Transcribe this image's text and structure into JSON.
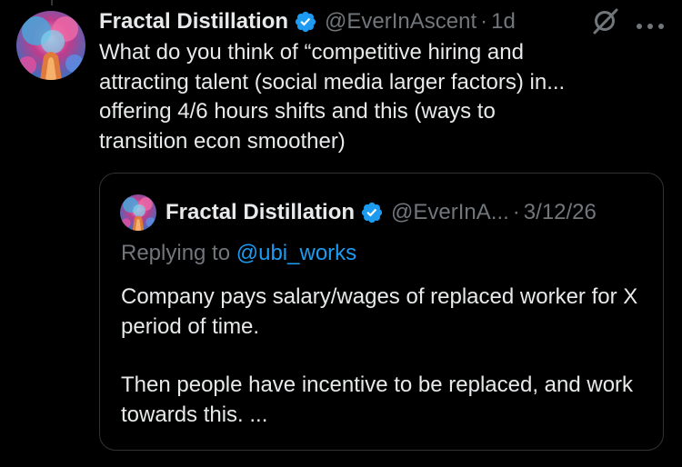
{
  "tweet": {
    "author_name": "Fractal Distillation",
    "handle": "@EverInAscent",
    "separator": "·",
    "time": "1d",
    "text": "What do you think of “competitive hiring and\nattracting talent (social media larger factors) in...\noffering 4/6 hours shifts and this (ways to\ntransition econ smoother)"
  },
  "quoted_tweet": {
    "author_name": "Fractal Distillation",
    "handle": "@EverInA...",
    "separator": "·",
    "date": "3/12/26",
    "replying_prefix": "Replying to",
    "replying_handle": "@ubi_works",
    "paragraphs": [
      "Company pays salary/wages of replaced worker for X period of time.",
      "Then people have incentive to be replaced, and work towards this. ..."
    ]
  },
  "icons": {
    "verified": "verified-badge-icon",
    "grok": "grok-icon",
    "more": "more-options-icon"
  },
  "colors": {
    "background": "#000000",
    "text_primary": "#e7e9ea",
    "text_secondary": "#71767b",
    "accent": "#1d9bf0",
    "border": "#2f3336"
  }
}
